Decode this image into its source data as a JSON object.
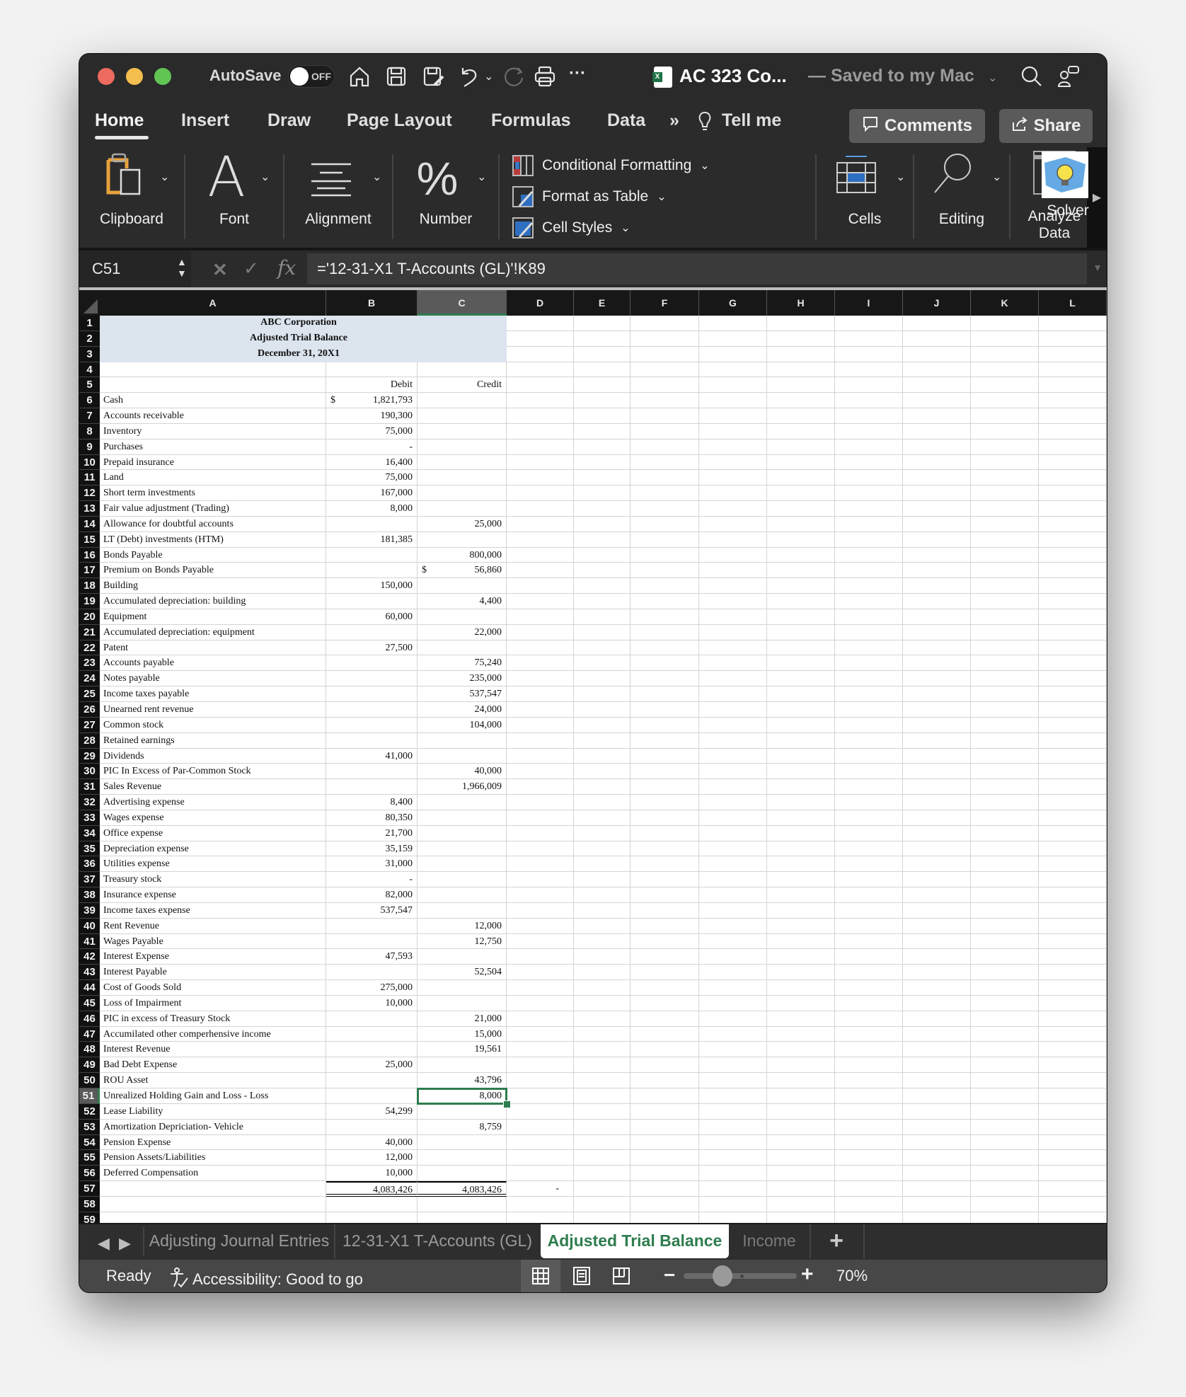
{
  "titlebar": {
    "autosave_label": "AutoSave",
    "autosave_state": "OFF",
    "doc_title": "AC 323 Co...",
    "save_status": "— Saved to my Mac",
    "icons": [
      "home-icon",
      "save-icon",
      "save-as-icon",
      "undo-icon",
      "redo-icon",
      "print-icon",
      "more-icon",
      "search-icon",
      "share-people-icon"
    ]
  },
  "ribbon_tabs": [
    "Home",
    "Insert",
    "Draw",
    "Page Layout",
    "Formulas",
    "Data"
  ],
  "ribbon_more": "»",
  "tell_me": "Tell me",
  "comments_label": "Comments",
  "share_label": "Share",
  "ribbon_groups": {
    "clipboard": "Clipboard",
    "font": "Font",
    "alignment": "Alignment",
    "number": "Number",
    "conditional_formatting": "Conditional Formatting",
    "format_as_table": "Format as Table",
    "cell_styles": "Cell Styles",
    "cells": "Cells",
    "editing": "Editing",
    "analyze_data": "Analyze Data",
    "solver": "Solver"
  },
  "formula_bar": {
    "name_box": "C51",
    "fx_label": "fx",
    "formula": "='12-31-X1 T-Accounts (GL)'!K89"
  },
  "columns": [
    "A",
    "B",
    "C",
    "D",
    "E",
    "F",
    "G",
    "H",
    "I",
    "J",
    "K",
    "L"
  ],
  "selected_column": "C",
  "selected_row": 51,
  "sheet": {
    "title_lines": [
      "ABC Corporation",
      "Adjusted Trial Balance",
      "December 31, 20X1"
    ],
    "header_debit": "Debit",
    "header_credit": "Credit",
    "rows": [
      {
        "row": 6,
        "account": "Cash",
        "debit": "1,821,793",
        "credit": "",
        "debit_dollar": true
      },
      {
        "row": 7,
        "account": "Accounts receivable",
        "debit": "190,300",
        "credit": ""
      },
      {
        "row": 8,
        "account": "Inventory",
        "debit": "75,000",
        "credit": ""
      },
      {
        "row": 9,
        "account": "Purchases",
        "debit": "-",
        "credit": ""
      },
      {
        "row": 10,
        "account": "Prepaid insurance",
        "debit": "16,400",
        "credit": ""
      },
      {
        "row": 11,
        "account": "Land",
        "debit": "75,000",
        "credit": ""
      },
      {
        "row": 12,
        "account": "Short term investments",
        "debit": "167,000",
        "credit": ""
      },
      {
        "row": 13,
        "account": "Fair value adjustment (Trading)",
        "debit": "8,000",
        "credit": ""
      },
      {
        "row": 14,
        "account": "Allowance for doubtful accounts",
        "debit": "",
        "credit": "25,000"
      },
      {
        "row": 15,
        "account": "LT (Debt) investments (HTM)",
        "debit": "181,385",
        "credit": ""
      },
      {
        "row": 16,
        "account": "Bonds Payable",
        "debit": "",
        "credit": "800,000"
      },
      {
        "row": 17,
        "account": "Premium on Bonds Payable",
        "debit": "",
        "credit": "56,860",
        "credit_dollar": true
      },
      {
        "row": 18,
        "account": "Building",
        "debit": "150,000",
        "credit": ""
      },
      {
        "row": 19,
        "account": "Accumulated depreciation: building",
        "debit": "",
        "credit": "4,400"
      },
      {
        "row": 20,
        "account": "Equipment",
        "debit": "60,000",
        "credit": ""
      },
      {
        "row": 21,
        "account": "Accumulated depreciation: equipment",
        "debit": "",
        "credit": "22,000"
      },
      {
        "row": 22,
        "account": "Patent",
        "debit": "27,500",
        "credit": ""
      },
      {
        "row": 23,
        "account": "Accounts payable",
        "debit": "",
        "credit": "75,240"
      },
      {
        "row": 24,
        "account": "Notes payable",
        "debit": "",
        "credit": "235,000"
      },
      {
        "row": 25,
        "account": "Income taxes payable",
        "debit": "",
        "credit": "537,547"
      },
      {
        "row": 26,
        "account": "Unearned rent revenue",
        "debit": "",
        "credit": "24,000"
      },
      {
        "row": 27,
        "account": "Common stock",
        "debit": "",
        "credit": "104,000"
      },
      {
        "row": 28,
        "account": "Retained earnings",
        "debit": "",
        "credit": ""
      },
      {
        "row": 29,
        "account": "Dividends",
        "debit": "41,000",
        "credit": ""
      },
      {
        "row": 30,
        "account": "PIC In Excess of Par-Common Stock",
        "debit": "",
        "credit": "40,000"
      },
      {
        "row": 31,
        "account": "Sales Revenue",
        "debit": "",
        "credit": "1,966,009"
      },
      {
        "row": 32,
        "account": "Advertising expense",
        "debit": "8,400",
        "credit": ""
      },
      {
        "row": 33,
        "account": "Wages expense",
        "debit": "80,350",
        "credit": ""
      },
      {
        "row": 34,
        "account": "Office expense",
        "debit": "21,700",
        "credit": ""
      },
      {
        "row": 35,
        "account": "Depreciation expense",
        "debit": "35,159",
        "credit": ""
      },
      {
        "row": 36,
        "account": "Utilities expense",
        "debit": "31,000",
        "credit": ""
      },
      {
        "row": 37,
        "account": "Treasury stock",
        "debit": "-",
        "credit": ""
      },
      {
        "row": 38,
        "account": "Insurance expense",
        "debit": "82,000",
        "credit": ""
      },
      {
        "row": 39,
        "account": "Income taxes expense",
        "debit": "537,547",
        "credit": ""
      },
      {
        "row": 40,
        "account": "Rent Revenue",
        "debit": "",
        "credit": "12,000"
      },
      {
        "row": 41,
        "account": "Wages Payable",
        "debit": "",
        "credit": "12,750"
      },
      {
        "row": 42,
        "account": "Interest Expense",
        "debit": "47,593",
        "credit": ""
      },
      {
        "row": 43,
        "account": "Interest Payable",
        "debit": "",
        "credit": "52,504"
      },
      {
        "row": 44,
        "account": "Cost of Goods Sold",
        "debit": "275,000",
        "credit": ""
      },
      {
        "row": 45,
        "account": "Loss of Impairment",
        "debit": "10,000",
        "credit": ""
      },
      {
        "row": 46,
        "account": "PIC in excess of Treasury Stock",
        "debit": "",
        "credit": "21,000"
      },
      {
        "row": 47,
        "account": "Accumilated other comperhensive income",
        "debit": "",
        "credit": "15,000"
      },
      {
        "row": 48,
        "account": "Interest Revenue",
        "debit": "",
        "credit": "19,561"
      },
      {
        "row": 49,
        "account": "Bad Debt Expense",
        "debit": "25,000",
        "credit": ""
      },
      {
        "row": 50,
        "account": "ROU Asset",
        "debit": "",
        "credit": "43,796"
      },
      {
        "row": 51,
        "account": "Unrealized Holding Gain and Loss - Loss",
        "debit": "",
        "credit": "8,000"
      },
      {
        "row": 52,
        "account": "Lease Liability",
        "debit": "54,299",
        "credit": ""
      },
      {
        "row": 53,
        "account": "Amortization Depriciation- Vehicle",
        "debit": "",
        "credit": "8,759"
      },
      {
        "row": 54,
        "account": "Pension Expense",
        "debit": "40,000",
        "credit": ""
      },
      {
        "row": 55,
        "account": "Pension Assets/Liabilities",
        "debit": "12,000",
        "credit": ""
      },
      {
        "row": 56,
        "account": "Deferred Compensation",
        "debit": "10,000",
        "credit": ""
      }
    ],
    "totals": {
      "row": 57,
      "debit": "4,083,426",
      "credit": "4,083,426",
      "difference": "-"
    },
    "dollar_sign": "$"
  },
  "sheet_tabs": [
    {
      "label": "Adjusting Journal Entries",
      "active": false
    },
    {
      "label": "12-31-X1 T-Accounts (GL)",
      "active": false
    },
    {
      "label": "Adjusted Trial Balance",
      "active": true
    },
    {
      "label": "Income",
      "active": false
    }
  ],
  "add_sheet": "+",
  "status": {
    "ready": "Ready",
    "accessibility": "Accessibility: Good to go",
    "zoom_percent": "70%",
    "zoom_value": 70
  },
  "colors": {
    "accent_green": "#2e7d4f",
    "title_fill": "#dce4ee",
    "chrome_dark": "#2b2b2b"
  }
}
